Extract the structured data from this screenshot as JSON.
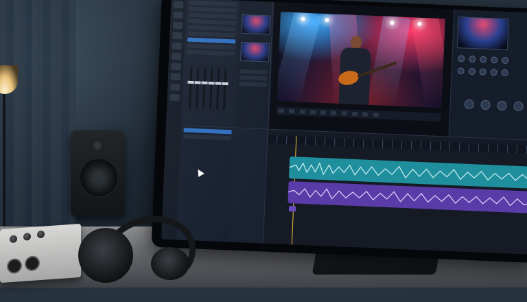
{
  "scene": {
    "description_text": ""
  },
  "colors": {
    "track_teal": "#1f8f9e",
    "track_purple": "#5a3ca8",
    "playhead": "#f0c23a",
    "accent_blue": "#2f6fc0"
  },
  "icons": [
    "playhead-marker",
    "mouse-cursor-icon",
    "transport-controls"
  ]
}
